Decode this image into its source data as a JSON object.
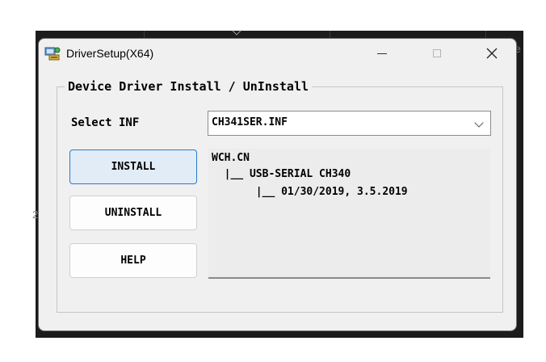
{
  "window": {
    "title": "DriverSetup(X64)",
    "close_glyph": "✕"
  },
  "background": {
    "left_digit": "2",
    "right_letter": "e"
  },
  "group": {
    "title": "Device Driver Install / UnInstall"
  },
  "select_inf": {
    "label": "Select INF",
    "value": "CH341SER.INF"
  },
  "buttons": {
    "install": "INSTALL",
    "uninstall": "UNINSTALL",
    "help": "HELP"
  },
  "info": {
    "lines": [
      "WCH.CN",
      "  |__ USB-SERIAL CH340",
      "       |__ 01/30/2019, 3.5.2019"
    ]
  },
  "colors": {
    "accent": "#2a79c9",
    "install_fill": "#e1ecf7",
    "window_bg": "#f0f0f0"
  },
  "icons": [
    "driver-setup-icon",
    "minimize-icon",
    "maximize-icon",
    "close-icon",
    "chevron-down-icon"
  ]
}
